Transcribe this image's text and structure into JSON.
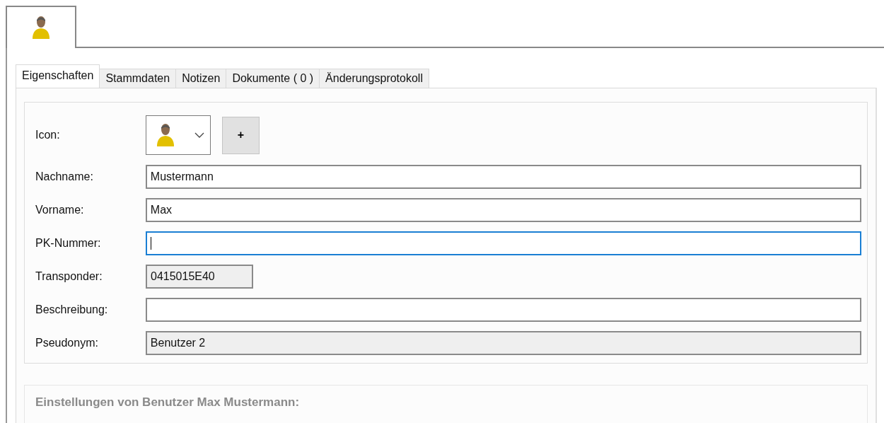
{
  "header_tab": {
    "selected": true
  },
  "tabs": [
    {
      "label": "Eigenschaften",
      "selected": true
    },
    {
      "label": "Stammdaten",
      "selected": false
    },
    {
      "label": "Notizen",
      "selected": false
    },
    {
      "label": "Dokumente  ( 0 )",
      "selected": false
    },
    {
      "label": "Änderungsprotokoll",
      "selected": false
    }
  ],
  "fields": [
    {
      "kind": "combo",
      "label": "Icon:",
      "button": "+"
    },
    {
      "kind": "text",
      "label": "Nachname:",
      "value": "Mustermann",
      "disabled": false,
      "focused": false
    },
    {
      "kind": "text",
      "label": "Vorname:",
      "value": "Max",
      "disabled": false,
      "focused": false
    },
    {
      "kind": "text",
      "label": "PK-Nummer:",
      "disabled": false,
      "focused": true
    },
    {
      "kind": "short_text",
      "label": "Transponder:",
      "value": "0415015E40",
      "disabled": true,
      "focused": false
    },
    {
      "kind": "text",
      "label": "Beschreibung:",
      "disabled": false,
      "focused": false
    },
    {
      "kind": "text",
      "label": "Pseudonym:",
      "value": "Benutzer 2",
      "disabled": true,
      "focused": false
    }
  ],
  "settings_group": {
    "title": "Einstellungen von Benutzer Max Mustermann:"
  }
}
